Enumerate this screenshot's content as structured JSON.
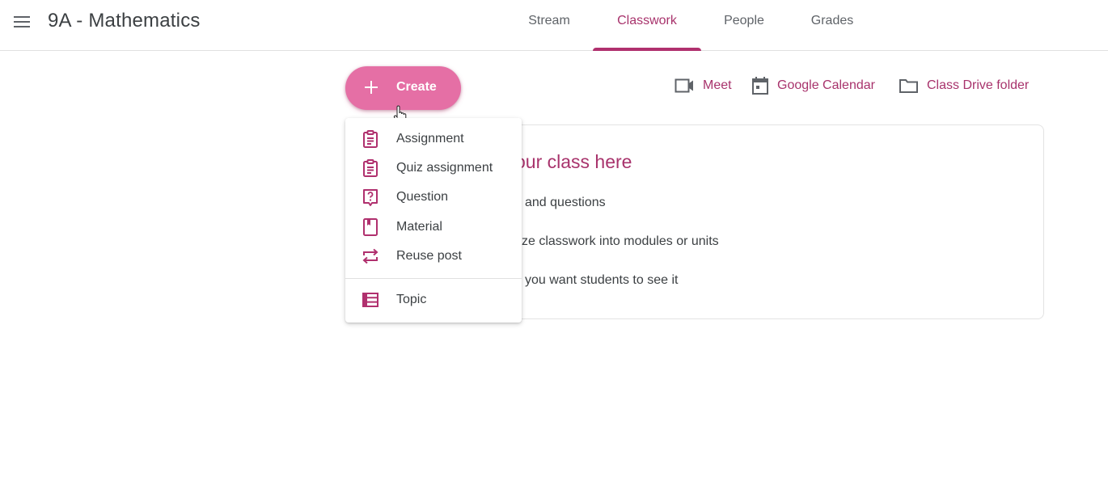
{
  "header": {
    "menu_icon": "hamburger-menu-icon",
    "class_title": "9A - Mathematics",
    "tabs": [
      {
        "label": "Stream",
        "active": false
      },
      {
        "label": "Classwork",
        "active": true
      },
      {
        "label": "People",
        "active": false
      },
      {
        "label": "Grades",
        "active": false
      }
    ]
  },
  "toolbar": {
    "create_label": "Create",
    "create_icon": "plus-icon",
    "links": [
      {
        "label": "Meet",
        "icon": "video-camera-icon"
      },
      {
        "label": "Google Calendar",
        "icon": "calendar-icon"
      },
      {
        "label": "Class Drive folder",
        "icon": "folder-icon"
      }
    ]
  },
  "create_menu": {
    "items": [
      {
        "label": "Assignment",
        "icon": "assignment-icon"
      },
      {
        "label": "Quiz assignment",
        "icon": "quiz-assignment-icon"
      },
      {
        "label": "Question",
        "icon": "question-icon"
      },
      {
        "label": "Material",
        "icon": "material-icon"
      },
      {
        "label": "Reuse post",
        "icon": "reuse-post-icon"
      },
      {
        "label": "Topic",
        "icon": "topic-icon"
      }
    ]
  },
  "empty_state": {
    "title_partial": "our class here",
    "lines": [
      "and questions",
      "ze classwork into modules or units",
      "you want students to see it"
    ]
  },
  "colors": {
    "accent": "#a8336c",
    "create_button": "#e56fa5",
    "tab_underline": "#b0306e",
    "text": "#3c4043",
    "muted": "#5f6368"
  }
}
